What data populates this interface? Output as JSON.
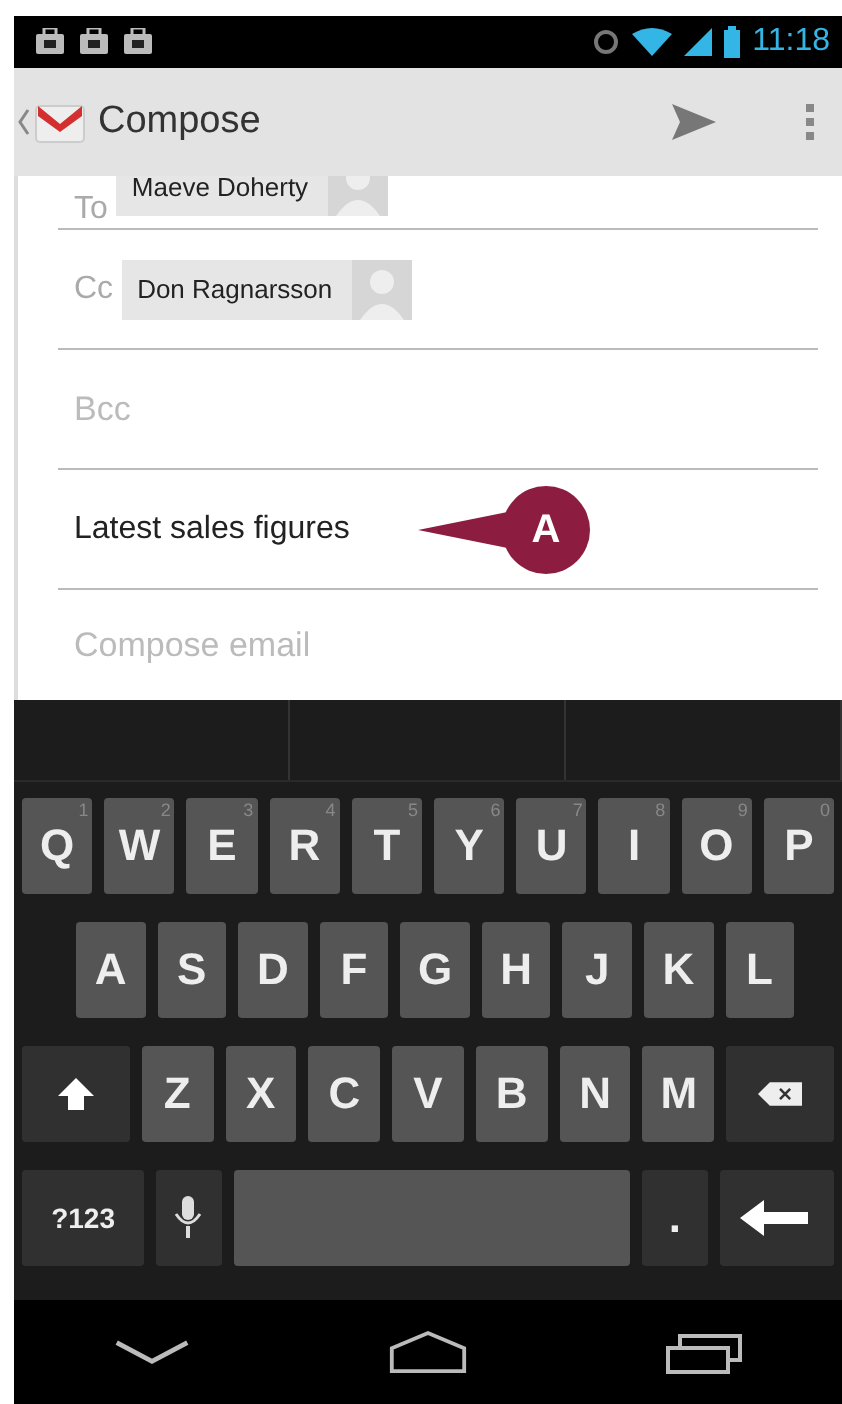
{
  "status_bar": {
    "time": "11:18"
  },
  "action_bar": {
    "title": "Compose"
  },
  "fields": [
    {
      "kind": "chips",
      "label": "To",
      "chips": [
        "Maeve Doherty"
      ]
    },
    {
      "kind": "chips",
      "label": "Cc",
      "chips": [
        "Don Ragnarsson"
      ]
    },
    {
      "kind": "placeholder",
      "placeholder": "Bcc"
    },
    {
      "kind": "value",
      "value": "Latest sales figures",
      "callout": "A"
    },
    {
      "kind": "body",
      "placeholder": "Compose email"
    }
  ],
  "keyboard": {
    "rows": [
      [
        {
          "kind": "letter",
          "label": "Q",
          "hint": "1"
        },
        {
          "kind": "letter",
          "label": "W",
          "hint": "2"
        },
        {
          "kind": "letter",
          "label": "E",
          "hint": "3"
        },
        {
          "kind": "letter",
          "label": "R",
          "hint": "4"
        },
        {
          "kind": "letter",
          "label": "T",
          "hint": "5"
        },
        {
          "kind": "letter",
          "label": "Y",
          "hint": "6"
        },
        {
          "kind": "letter",
          "label": "U",
          "hint": "7"
        },
        {
          "kind": "letter",
          "label": "I",
          "hint": "8"
        },
        {
          "kind": "letter",
          "label": "O",
          "hint": "9"
        },
        {
          "kind": "letter",
          "label": "P",
          "hint": "0"
        }
      ],
      [
        {
          "kind": "letter",
          "label": "A"
        },
        {
          "kind": "letter",
          "label": "S"
        },
        {
          "kind": "letter",
          "label": "D"
        },
        {
          "kind": "letter",
          "label": "F"
        },
        {
          "kind": "letter",
          "label": "G"
        },
        {
          "kind": "letter",
          "label": "H"
        },
        {
          "kind": "letter",
          "label": "J"
        },
        {
          "kind": "letter",
          "label": "K"
        },
        {
          "kind": "letter",
          "label": "L"
        }
      ],
      [
        {
          "kind": "shift"
        },
        {
          "kind": "letter",
          "label": "Z"
        },
        {
          "kind": "letter",
          "label": "X"
        },
        {
          "kind": "letter",
          "label": "C"
        },
        {
          "kind": "letter",
          "label": "V"
        },
        {
          "kind": "letter",
          "label": "B"
        },
        {
          "kind": "letter",
          "label": "N"
        },
        {
          "kind": "letter",
          "label": "M"
        },
        {
          "kind": "delete"
        }
      ]
    ],
    "bottom_row": [
      {
        "kind": "symbols",
        "label": "?123"
      },
      {
        "kind": "mic"
      },
      {
        "kind": "space"
      },
      {
        "kind": "period",
        "label": "."
      },
      {
        "kind": "enter"
      }
    ]
  }
}
